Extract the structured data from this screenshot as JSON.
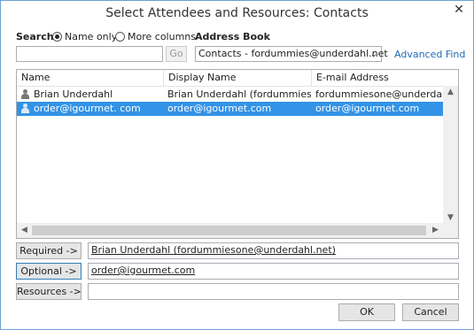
{
  "window": {
    "title": "Select Attendees and Resources: Contacts",
    "close_glyph": "✕"
  },
  "search": {
    "label": "Search:",
    "option_name_only": "Name only",
    "option_more_columns": "More columns",
    "selected_option": "Name only",
    "query_value": "",
    "go_label": "Go"
  },
  "address_book": {
    "label": "Address Book",
    "selected": "Contacts - fordummies@underdahl.net",
    "advanced_find": "Advanced Find"
  },
  "list": {
    "columns": [
      "Name",
      "Display Name",
      "E-mail Address"
    ],
    "rows": [
      {
        "name": "Brian Underdahl",
        "display_name": "Brian Underdahl (fordummiesone@underdahl.net)",
        "email": "fordummiesone@underdahl.net",
        "selected": false
      },
      {
        "name": "order@igourmet. com",
        "display_name": "order@igourmet.com",
        "email": "order@igourmet.com",
        "selected": true
      }
    ]
  },
  "recipients": {
    "required_label": "Required ->",
    "required_value": "Brian Underdahl (fordummiesone@underdahl.net)",
    "optional_label": "Optional ->",
    "optional_value": "order@igourmet.com",
    "resources_label": "Resources ->",
    "resources_value": ""
  },
  "footer": {
    "ok_label": "OK",
    "cancel_label": "Cancel"
  },
  "colors": {
    "selection": "#3393e6",
    "link": "#1e6cb5",
    "border": "#6d9fd0"
  }
}
